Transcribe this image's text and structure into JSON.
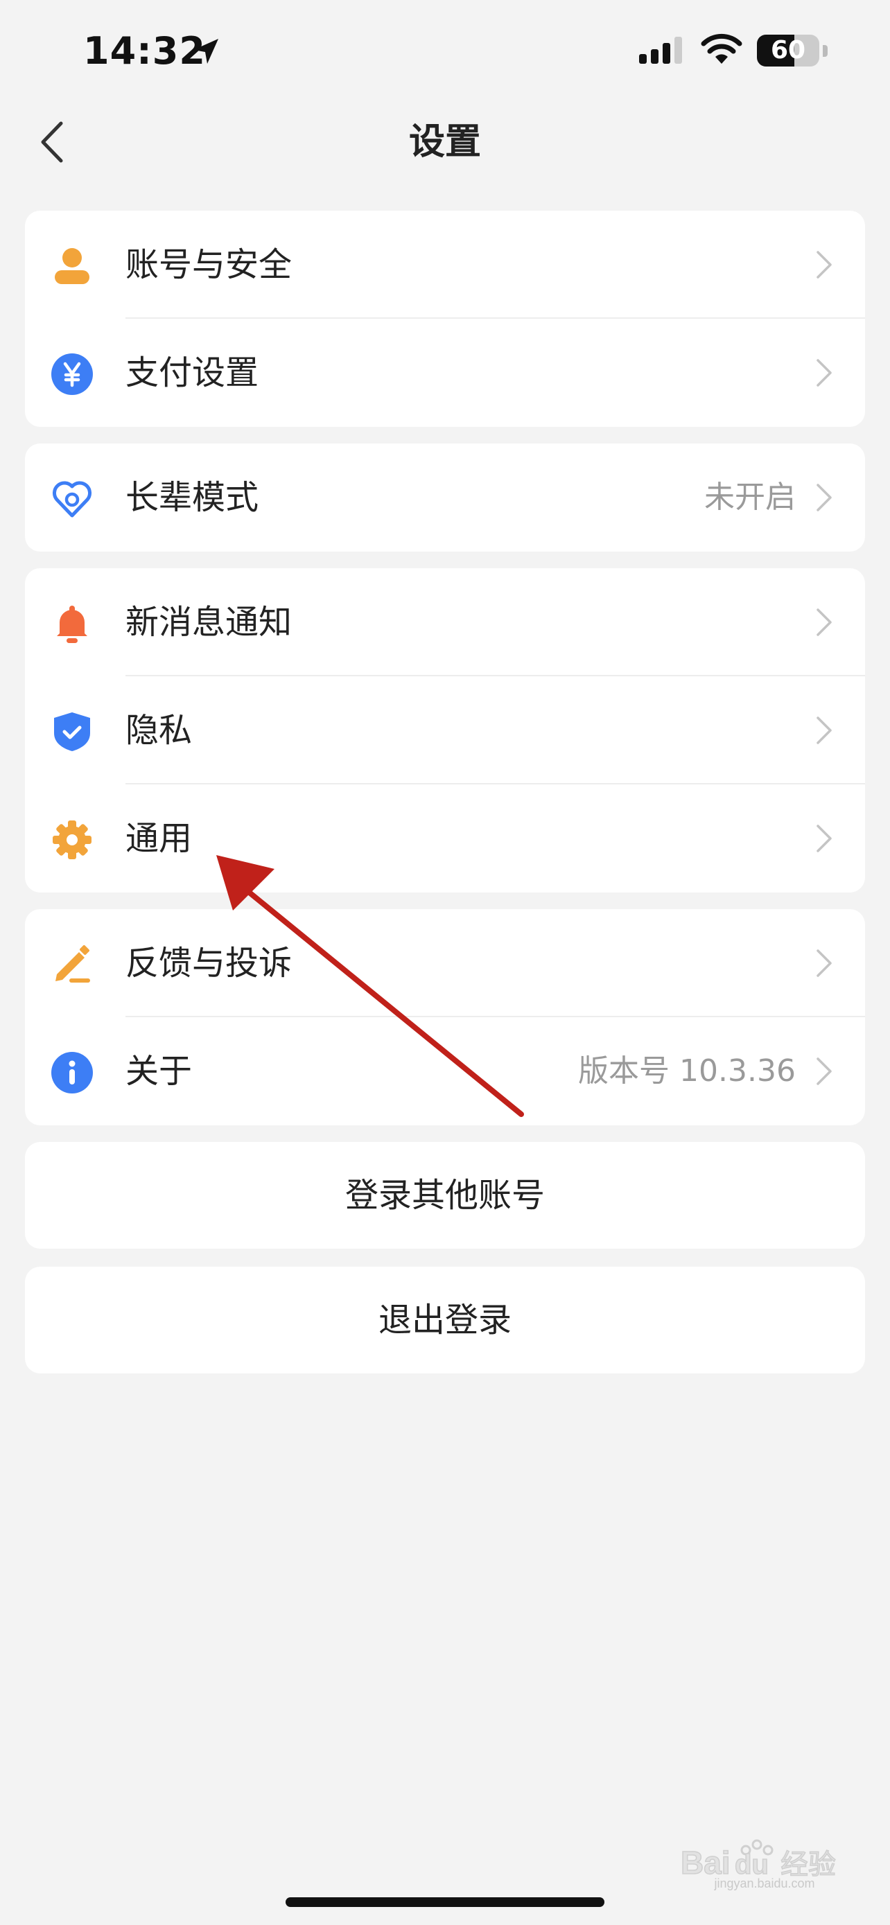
{
  "status_bar": {
    "time": "14:32",
    "battery": "60",
    "battery_level": 0.6
  },
  "nav": {
    "title": "设置"
  },
  "groups": [
    {
      "items": [
        {
          "label": "账号与安全",
          "icon": "person-icon",
          "value": ""
        },
        {
          "label": "支付设置",
          "icon": "yen-icon",
          "value": ""
        }
      ]
    },
    {
      "items": [
        {
          "label": "长辈模式",
          "icon": "heart-icon",
          "value": "未开启"
        }
      ]
    },
    {
      "items": [
        {
          "label": "新消息通知",
          "icon": "bell-icon",
          "value": ""
        },
        {
          "label": "隐私",
          "icon": "shield-icon",
          "value": ""
        },
        {
          "label": "通用",
          "icon": "gear-icon",
          "value": ""
        }
      ]
    },
    {
      "items": [
        {
          "label": "反馈与投诉",
          "icon": "pencil-icon",
          "value": ""
        },
        {
          "label": "关于",
          "icon": "info-icon",
          "value": "版本号 10.3.36"
        }
      ]
    }
  ],
  "buttons": {
    "switch_account": "登录其他账号",
    "logout": "退出登录"
  },
  "watermark": {
    "text": "jingyan.baidu.com"
  },
  "colors": {
    "orange": "#f2a43a",
    "blue": "#3d7ef5",
    "bell": "#f26a3c",
    "arrow": "#c0211a",
    "background": "#f3f3f3"
  }
}
